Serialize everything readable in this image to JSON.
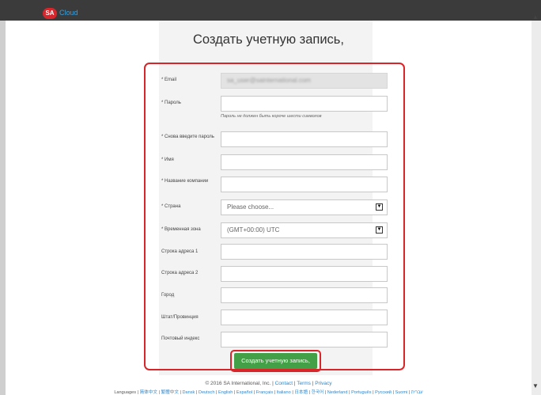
{
  "header": {
    "logo_badge": "SA",
    "logo_text": "Cloud"
  },
  "form": {
    "title": "Создать учетную запись,",
    "email_label": "* Email",
    "email_value": "sa_user@sainternational.com",
    "password_label": "* Пароль",
    "password_hint": "Пароль не должен быть короче шести символов",
    "password_confirm_label": "* Снова введите пароль",
    "name_label": "* Имя",
    "company_label": "* Название компании",
    "country_label": "* Страна",
    "country_selected": "Please choose...",
    "timezone_label": "* Временная зона",
    "timezone_selected": "(GMT+00:00) UTC",
    "address1_label": "Строка адреса 1",
    "address2_label": "Строка адреса 2",
    "city_label": "Город",
    "state_label": "Штат/Провинция",
    "zip_label": "Почтовый индекс",
    "submit_label": "Создать учетную запись,"
  },
  "footer": {
    "copyright": "© 2016 SA International, Inc. |",
    "links": [
      "Contact",
      "Terms",
      "Privacy"
    ],
    "languages_prefix": "Languages |",
    "languages": [
      "简体中文",
      "繁體中文",
      "Dansk",
      "Deutsch",
      "English",
      "Español",
      "Français",
      "Italiano",
      "日本語",
      "한국어",
      "Nederland",
      "Português",
      "Русский",
      "Suomi",
      "עברית"
    ]
  },
  "colors": {
    "accent_red": "#d8252a",
    "button_green": "#43a047",
    "link_blue": "#2f86c8",
    "topbar": "#3b3b3b"
  }
}
